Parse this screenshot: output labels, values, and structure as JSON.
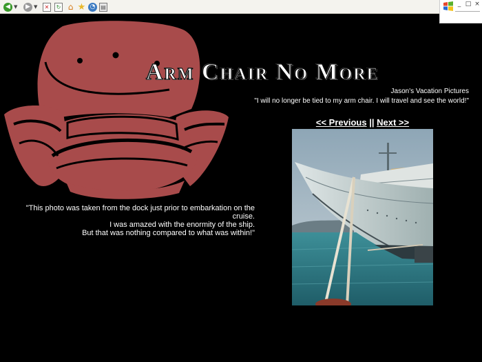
{
  "toolbar": {
    "icons": [
      "back-icon",
      "forward-icon",
      "stop-icon",
      "refresh-icon",
      "home-icon",
      "favorites-icon",
      "history-icon",
      "print-icon"
    ]
  },
  "window": {
    "minimize": "_",
    "restore": "□",
    "close": "×"
  },
  "site": {
    "title": "Arm Chair No More",
    "subtitle": "Jason's Vacation Pictures",
    "tagline": "\"I will no longer be tied to my arm chair. I will travel and see the world!\""
  },
  "nav": {
    "previous": "<< Previous",
    "separator": "||",
    "next": "Next >>"
  },
  "caption": {
    "line1": "\"This photo was taken from the dock just prior to embarkation on the cruise.",
    "line2": "I was amazed with the enormity of the ship.",
    "line3": "But that was nothing compared to what was within!\""
  },
  "colors": {
    "background": "#000000",
    "chair": "#a84b4b",
    "text": "#ffffff"
  }
}
